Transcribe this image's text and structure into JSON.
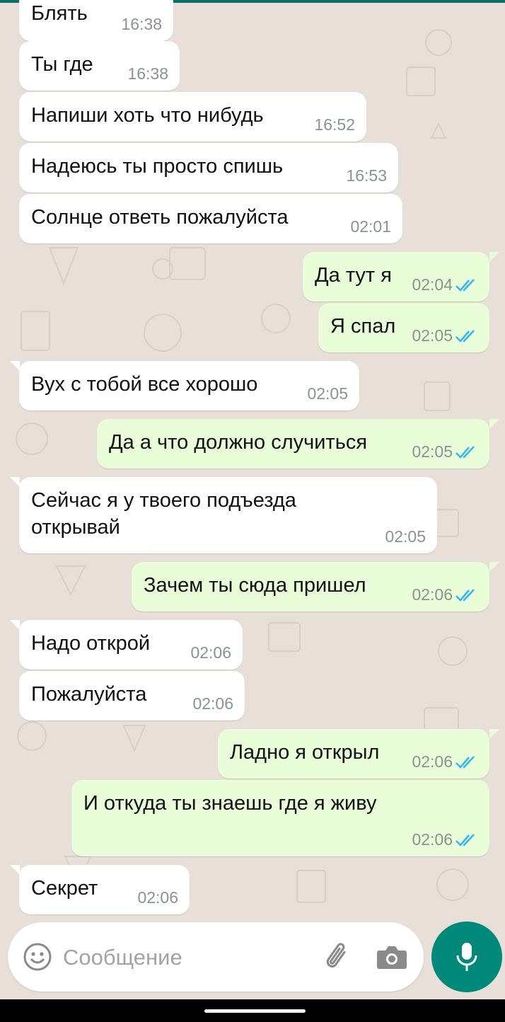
{
  "colors": {
    "background": "#e8e0d8",
    "incoming_bubble": "#ffffff",
    "outgoing_bubble": "#e8fdd8",
    "read_ticks": "#34b7f1",
    "accent": "#00897b"
  },
  "messages": [
    {
      "dir": "in",
      "text": "Блять",
      "time": "16:38"
    },
    {
      "dir": "in",
      "text": "Ты где",
      "time": "16:38"
    },
    {
      "dir": "in",
      "text": "Напиши хоть что нибудь",
      "time": "16:52"
    },
    {
      "dir": "in",
      "text": "Надеюсь ты просто спишь",
      "time": "16:53"
    },
    {
      "dir": "in",
      "text": "Солнце ответь пожалуйста",
      "time": "02:01"
    },
    {
      "dir": "out",
      "text": "Да тут я",
      "time": "02:04",
      "status": "read"
    },
    {
      "dir": "out",
      "text": "Я спал",
      "time": "02:05",
      "status": "read"
    },
    {
      "dir": "in",
      "text": "Вух с тобой все хорошо",
      "time": "02:05"
    },
    {
      "dir": "out",
      "text": "Да а что должно случиться",
      "time": "02:05",
      "status": "read"
    },
    {
      "dir": "in",
      "text": "Сейчас я у твоего подъезда\nоткрывай",
      "time": "02:05"
    },
    {
      "dir": "out",
      "text": "Зачем ты сюда пришел",
      "time": "02:06",
      "status": "read"
    },
    {
      "dir": "in",
      "text": "Надо открой",
      "time": "02:06"
    },
    {
      "dir": "in",
      "text": "Пожалуйста",
      "time": "02:06"
    },
    {
      "dir": "out",
      "text": "Ладно я открыл",
      "time": "02:06",
      "status": "read"
    },
    {
      "dir": "out",
      "text": "И откуда ты знаешь где я живу",
      "time": "02:06",
      "status": "read"
    },
    {
      "dir": "in",
      "text": "Секрет",
      "time": "02:06"
    }
  ],
  "composer": {
    "placeholder": "Сообщение",
    "emoji_icon": "smiley-icon",
    "attach_icon": "paperclip-icon",
    "camera_icon": "camera-icon"
  },
  "mic_button": {
    "icon": "microphone-icon"
  }
}
